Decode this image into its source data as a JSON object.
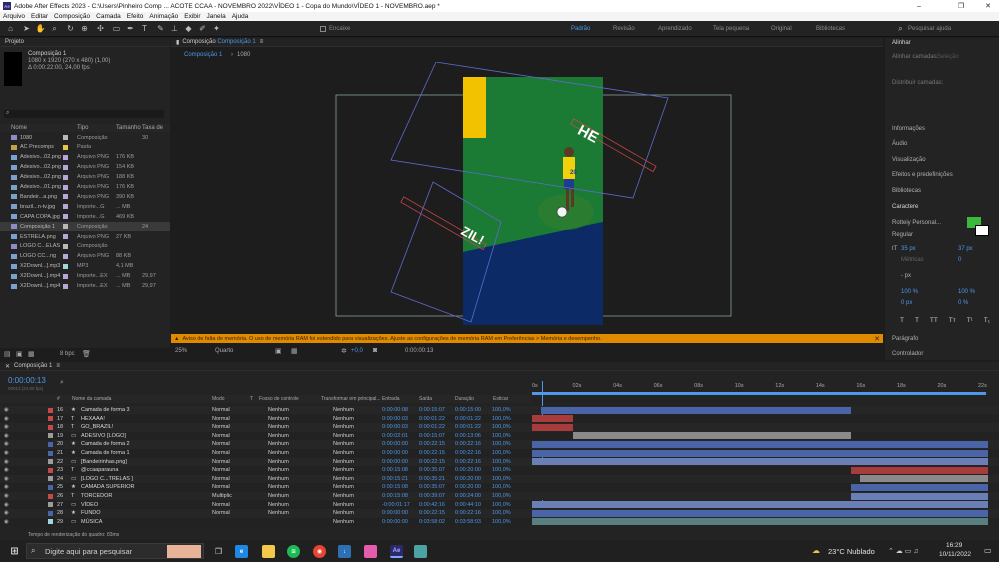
{
  "window": {
    "app_icon": "Ae",
    "title": "Adobe After Effects 2023 - C:\\Users\\Pinheiro Comp ... ACOTE CCAA - NOVEMBRO 2022\\VÍDEO 1 - Copa do Mundo\\VÍDEO 1 - NOVEMBRO.aep *",
    "controls": [
      "–",
      "❐",
      "✕"
    ]
  },
  "menu": [
    "Arquivo",
    "Editar",
    "Composição",
    "Camada",
    "Efeito",
    "Animação",
    "Exibir",
    "Janela",
    "Ajuda"
  ],
  "toolbar": {
    "encaixe": "Encaixe",
    "workspaces": [
      "Padrão",
      "Revisão",
      "Aprendizado",
      "Tela pequena",
      "Original",
      "Bibliotecas"
    ],
    "active_workspace": "Padrão",
    "search_placeholder": "Pesquisar ajuda"
  },
  "project": {
    "panel_title": "Projeto",
    "selected_name": "Composição 1",
    "info_line1": "1080 x 1920 (270 x 480) (1,00)",
    "info_line2": "Δ 0:00:22:00, 24,00 fps",
    "columns": [
      "Nome",
      "Tipo",
      "Tamanho",
      "Taxa de"
    ],
    "items": [
      {
        "name": "1080",
        "type": "Composição",
        "size": "",
        "rate": "30",
        "label": "#b8b8b8",
        "icon": "comp"
      },
      {
        "name": "AC Precomps",
        "type": "Pasta",
        "size": "",
        "rate": "",
        "label": "#e5c848",
        "icon": "folder"
      },
      {
        "name": "Adesivo...02.png",
        "type": "Arquivo PNG",
        "size": "176 KB",
        "rate": "",
        "label": "#b8a6d8",
        "icon": "file"
      },
      {
        "name": "Adesivo...02.png",
        "type": "Arquivo PNG",
        "size": "154 KB",
        "rate": "",
        "label": "#b8a6d8",
        "icon": "file"
      },
      {
        "name": "Adesivo...02.png",
        "type": "Arquivo PNG",
        "size": "188 KB",
        "rate": "",
        "label": "#b8a6d8",
        "icon": "file"
      },
      {
        "name": "Adesivo...01.png",
        "type": "Arquivo PNG",
        "size": "176 KB",
        "rate": "",
        "label": "#b8a6d8",
        "icon": "file"
      },
      {
        "name": "Bandeir...a.png",
        "type": "Arquivo PNG",
        "size": "390 KB",
        "rate": "",
        "label": "#b8a6d8",
        "icon": "file"
      },
      {
        "name": "brazil...n-tv.jpg",
        "type": "Importe...G",
        "size": "... MB",
        "rate": "",
        "label": "#b8a6d8",
        "icon": "file"
      },
      {
        "name": "CAPA COPA.jpg",
        "type": "Importe...G",
        "size": "469 KB",
        "rate": "",
        "label": "#b8a6d8",
        "icon": "file"
      },
      {
        "name": "Composição 1",
        "type": "Composição",
        "size": "",
        "rate": "24",
        "label": "#b8b8b8",
        "icon": "comp",
        "selected": true
      },
      {
        "name": "ESTRELA.png",
        "type": "Arquivo PNG",
        "size": "27 KB",
        "rate": "",
        "label": "#b8a6d8",
        "icon": "file"
      },
      {
        "name": "LOGO C...ELAS",
        "type": "Composição",
        "size": "",
        "rate": "",
        "label": "#b8b8b8",
        "icon": "comp"
      },
      {
        "name": "LOGO CC...ng",
        "type": "Arquivo PNG",
        "size": "88 KB",
        "rate": "",
        "label": "#b8a6d8",
        "icon": "file"
      },
      {
        "name": "X2Downl...].mp3",
        "type": "MP3",
        "size": "4,1 MB",
        "rate": "",
        "label": "#9fd8d8",
        "icon": "file"
      },
      {
        "name": "X2Downl...].mp4",
        "type": "Importe...EX",
        "size": "... MB",
        "rate": "29,97",
        "label": "#b8a6d8",
        "icon": "file"
      },
      {
        "name": "X2Downl...].mp4",
        "type": "Importe...EX",
        "size": "... MB",
        "rate": "29,97",
        "label": "#b8a6d8",
        "icon": "file"
      }
    ],
    "footer_bpc": "8 bpc"
  },
  "composition": {
    "tab_prefix": "Composição",
    "tab_name": "Composição 1",
    "breadcrumb": [
      "Composição 1",
      "1080"
    ],
    "warning": "Aviso de falta de memória. O uso de memória RAM foi estendido para visualizações. Ajuste as configurações de memória RAM em Preferências > Memória e desempenho.",
    "zoom": "25%",
    "resolution": "Quarto",
    "exposure": "+0,0",
    "timecode": "0:00:00:13",
    "frame_text_top": "HE",
    "frame_text_bottom": "ZIL!",
    "player_number": "20"
  },
  "right_panel": {
    "align_title": "Alinhar",
    "align_to_label": "Alinhar camadas:",
    "align_to_value": "Seleção",
    "distribute_label": "Distribuir camadas:",
    "sections": [
      "Informações",
      "Áudio",
      "Visualização",
      "Efeitos e predefinições",
      "Bibliotecas"
    ],
    "character_title": "Caractere",
    "font_name": "Rotteiy Personal...",
    "font_style": "Regular",
    "font_size": "35 px",
    "leading": "37 px",
    "kerning": "Métricas",
    "tracking": "0",
    "stroke": "- px",
    "vscale": "100 %",
    "hscale": "100 %",
    "baseline": "0 px",
    "tsume": "0 %",
    "text_buttons": [
      "T",
      "T",
      "TT",
      "Tт",
      "T¹",
      "T₁"
    ],
    "paragraph": "Parágrafo",
    "controller": "Controlador"
  },
  "timeline": {
    "tab_name": "Composição 1",
    "timecode": "0:00:00:13",
    "timecode_sub": "00013 (24,00 fps)",
    "columns": [
      "#",
      "Nome da camada",
      "Modo",
      "T",
      "Fosso de controle",
      "Transformar em principal...",
      "Entrada",
      "Saída",
      "Duração",
      "Esticar"
    ],
    "ruler_marks": [
      "0s",
      "02s",
      "04s",
      "06s",
      "08s",
      "10s",
      "12s",
      "14s",
      "16s",
      "18s",
      "20s",
      "22s"
    ],
    "layers": [
      {
        "num": "16",
        "type": "★",
        "name": "Camada de forma 3",
        "mode": "Normal",
        "trk": "Nenhum",
        "parent": "Nenhum",
        "in": "0:00:00:08",
        "out": "0:00:15:07",
        "dur": "0:00:15:00",
        "stretch": "100,0%",
        "label": "#c24a4a",
        "bar_start": 0.02,
        "bar_end": 0.7,
        "bar_color": "#4a64a8"
      },
      {
        "num": "17",
        "type": "T",
        "name": "HEXAAA!",
        "mode": "Normal",
        "trk": "Nenhum",
        "parent": "Nenhum",
        "in": "0:00:00:03",
        "out": "0:00:01:22",
        "dur": "0:00:01:22",
        "stretch": "100,0%",
        "label": "#c24a4a",
        "bar_start": 0.0,
        "bar_end": 0.09,
        "bar_color": "#a83c3c"
      },
      {
        "num": "18",
        "type": "T",
        "name": "GO_BRAZIL!",
        "mode": "Normal",
        "trk": "Nenhum",
        "parent": "Nenhum",
        "in": "0:00:00:03",
        "out": "0:00:01:22",
        "dur": "0:00:01:22",
        "stretch": "100,0%",
        "label": "#c24a4a",
        "bar_start": 0.0,
        "bar_end": 0.09,
        "bar_color": "#a83c3c"
      },
      {
        "num": "19",
        "type": "▭",
        "name": "ADESIVO [LOGO]",
        "mode": "Normal",
        "trk": "Nenhum",
        "parent": "Nenhum",
        "in": "0:00:02:01",
        "out": "0:00:15:07",
        "dur": "0:00:13:06",
        "stretch": "100,0%",
        "label": "#9c9c9c",
        "bar_start": 0.09,
        "bar_end": 0.7,
        "bar_color": "#8a8a8a"
      },
      {
        "num": "20",
        "type": "★",
        "name": "Camada de forma 2",
        "mode": "Normal",
        "trk": "Nenhum",
        "parent": "Nenhum",
        "in": "0:00:00:00",
        "out": "0:00:22:15",
        "dur": "0:00:22:16",
        "stretch": "100,0%",
        "label": "#4a64a8",
        "bar_start": 0.0,
        "bar_end": 1.0,
        "bar_color": "#4a64a8"
      },
      {
        "num": "21",
        "type": "★",
        "name": "Camada de forma 1",
        "mode": "Normal",
        "trk": "Nenhum",
        "parent": "Nenhum",
        "in": "0:00:00:00",
        "out": "0:00:22:15",
        "dur": "0:00:22:16",
        "stretch": "100,0%",
        "label": "#4a64a8",
        "bar_start": 0.0,
        "bar_end": 1.0,
        "bar_color": "#4a64a8"
      },
      {
        "num": "22",
        "type": "▭",
        "name": "[Bandeirinhas.png]",
        "mode": "Normal",
        "trk": "Nenhum",
        "parent": "Nenhum",
        "in": "0:00:00:00",
        "out": "0:00:22:15",
        "dur": "0:00:22:16",
        "stretch": "100,0%",
        "label": "#9c9c9c",
        "bar_start": 0.0,
        "bar_end": 1.0,
        "bar_color": "#6a7fb5"
      },
      {
        "num": "23",
        "type": "T",
        "name": "@ccaaparauna",
        "mode": "Normal",
        "trk": "Nenhum",
        "parent": "Nenhum",
        "in": "0:00:15:08",
        "out": "0:00:35:07",
        "dur": "0:00:20:00",
        "stretch": "100,0%",
        "label": "#c24a4a",
        "bar_start": 0.7,
        "bar_end": 1.0,
        "bar_color": "#a83c3c"
      },
      {
        "num": "24",
        "type": "▭",
        "name": "[LOGO C...TRELAS ]",
        "mode": "Normal",
        "trk": "Nenhum",
        "parent": "Nenhum",
        "in": "0:00:15:21",
        "out": "0:00:35:21",
        "dur": "0:00:20:00",
        "stretch": "100,0%",
        "label": "#9c9c9c",
        "bar_start": 0.72,
        "bar_end": 1.0,
        "bar_color": "#8a8a8a"
      },
      {
        "num": "25",
        "type": "★",
        "name": "CAMADA SUPERIOR",
        "mode": "Normal",
        "trk": "Nenhum",
        "parent": "Nenhum",
        "in": "0:00:15:08",
        "out": "0:00:35:07",
        "dur": "0:00:20:00",
        "stretch": "100,0%",
        "label": "#4a64a8",
        "bar_start": 0.7,
        "bar_end": 1.0,
        "bar_color": "#4a64a8"
      },
      {
        "num": "26",
        "type": "T",
        "name": "TORCEDOR",
        "mode": "Multiplic",
        "trk": "Nenhum",
        "parent": "Nenhum",
        "in": "0:00:15:08",
        "out": "0:00:39:07",
        "dur": "0:00:24:00",
        "stretch": "100,0%",
        "label": "#c24a4a",
        "bar_start": 0.7,
        "bar_end": 1.0,
        "bar_color": "#6a7fb5"
      },
      {
        "num": "27",
        "type": "▭",
        "name": "VÍDEO",
        "mode": "Normal",
        "trk": "Nenhum",
        "parent": "Nenhum",
        "in": "-0:00:01:17",
        "out": "0:00:42:16",
        "dur": "0:00:44:10",
        "stretch": "100,0%",
        "label": "#9c9c9c",
        "bar_start": 0.0,
        "bar_end": 1.0,
        "bar_color": "#6a7fb5"
      },
      {
        "num": "28",
        "type": "★",
        "name": "FUNDO",
        "mode": "Normal",
        "trk": "Nenhum",
        "parent": "Nenhum",
        "in": "0:00:00:00",
        "out": "0:00:22:15",
        "dur": "0:00:22:16",
        "stretch": "100,0%",
        "label": "#4a64a8",
        "bar_start": 0.0,
        "bar_end": 1.0,
        "bar_color": "#4a64a8"
      },
      {
        "num": "29",
        "type": "▭",
        "name": "MÚSICA",
        "mode": "",
        "trk": "",
        "parent": "Nenhum",
        "in": "0:00:00:00",
        "out": "0:03:58:02",
        "dur": "0:03:58:03",
        "stretch": "100,0%",
        "label": "#9fd8d8",
        "bar_start": 0.0,
        "bar_end": 1.0,
        "bar_color": "#5a7f7f"
      }
    ],
    "footer": "Tempo de renderização do quadro: 83ms"
  },
  "taskbar": {
    "search_placeholder": "Digite aqui para pesquisar",
    "weather": "23°C  Nublado",
    "time": "16:29",
    "date": "10/11/2022"
  },
  "colors": {
    "accent_blue": "#4f97e8",
    "warning_orange": "#e08a00",
    "brazil_green": "#1b7a34",
    "brazil_yellow": "#f2c100",
    "brazil_blue": "#0b2a66"
  }
}
